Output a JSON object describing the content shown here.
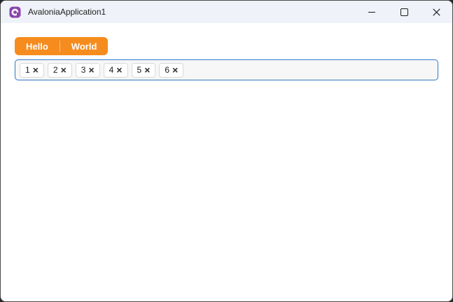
{
  "window": {
    "title": "AvaloniaApplication1"
  },
  "icons": {
    "app": "avalonia-logo-icon",
    "minimize": "minimize-icon",
    "maximize": "maximize-icon",
    "close": "close-icon",
    "chip_remove_glyph": "×"
  },
  "colors": {
    "titlebar_bg": "#EFF3F9",
    "accent_orange": "#F68C1E",
    "focus_border_blue": "#2E79C7",
    "logo_purple": "#8B44AC",
    "window_border": "#4a4a4a"
  },
  "tabs": {
    "items": [
      "Hello",
      "World"
    ]
  },
  "chips": {
    "items": [
      "1",
      "2",
      "3",
      "4",
      "5",
      "6"
    ]
  }
}
